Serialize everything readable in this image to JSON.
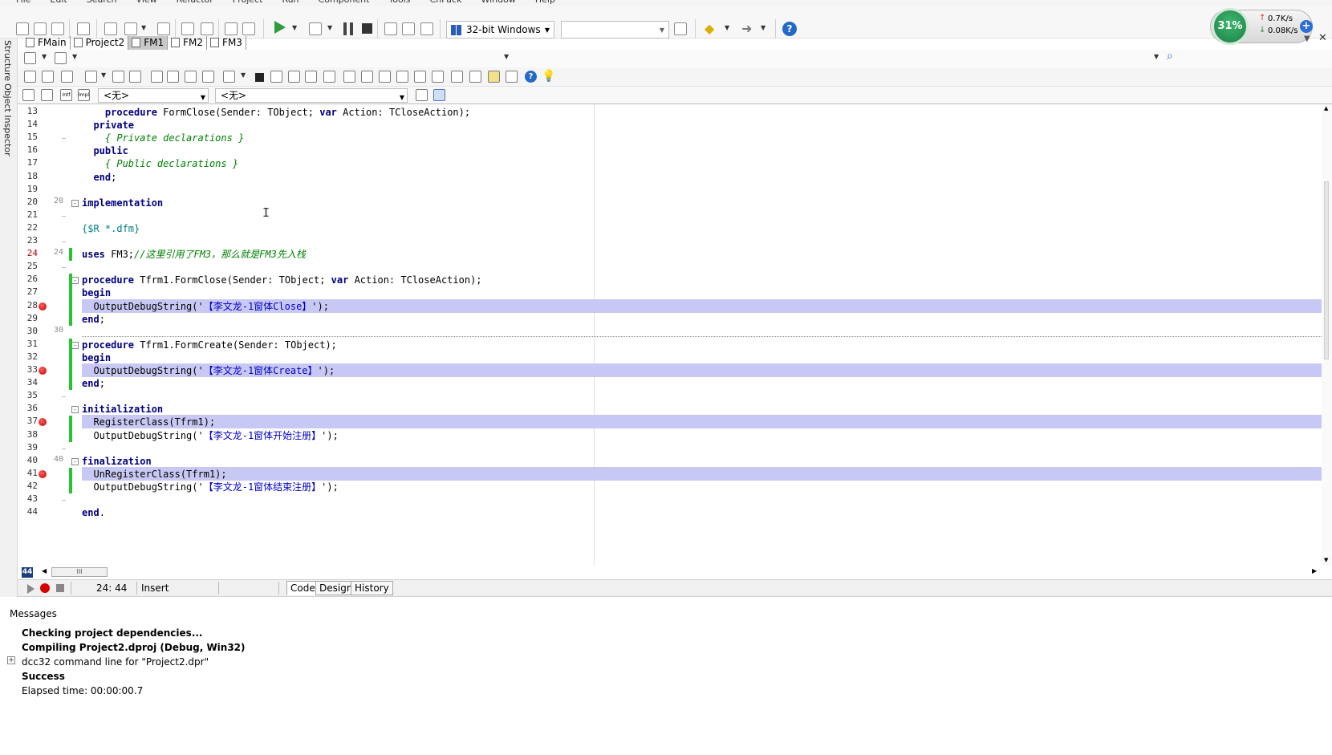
{
  "menu": [
    "File",
    "Edit",
    "Search",
    "View",
    "Refactor",
    "Project",
    "Run",
    "Component",
    "Tools",
    "CnPack",
    "Window",
    "Help"
  ],
  "toolbar": {
    "platform": "32-bit Windows",
    "config": ""
  },
  "speed_widget": {
    "cpu": "31%",
    "up": "0.7K/s",
    "down": "0.08K/s",
    "plus": "+"
  },
  "left_dock": {
    "tab_structure": "Structure",
    "tab_object_inspector": "Object Inspector"
  },
  "file_tabs": [
    {
      "label": "FMain",
      "active": false
    },
    {
      "label": "Project2",
      "active": false
    },
    {
      "label": "FM1",
      "active": true
    },
    {
      "label": "FM2",
      "active": false
    },
    {
      "label": "FM3",
      "active": false
    }
  ],
  "toolbar4": {
    "combo1": "<无>",
    "combo2": "<无>",
    "intf_label": "Intf",
    "impl_label": "Impl"
  },
  "editor": {
    "lines": [
      {
        "n": "13",
        "text": "    procedure FormClose(Sender: TObject; var Action: TCloseAction);"
      },
      {
        "n": "14",
        "text": "  private"
      },
      {
        "n": "15",
        "text": "    { Private declarations }"
      },
      {
        "n": "16",
        "text": "  public"
      },
      {
        "n": "17",
        "text": "    { Public declarations }"
      },
      {
        "n": "18",
        "text": "  end;"
      },
      {
        "n": "19",
        "text": ""
      },
      {
        "n": "20",
        "text": "implementation"
      },
      {
        "n": "21",
        "text": ""
      },
      {
        "n": "22",
        "text": "{$R *.dfm}"
      },
      {
        "n": "23",
        "text": ""
      },
      {
        "n": "24",
        "text": "uses FM3;//这里引用了FM3，那么就是FM3先入栈"
      },
      {
        "n": "25",
        "text": ""
      },
      {
        "n": "26",
        "text": "procedure Tfrm1.FormClose(Sender: TObject; var Action: TCloseAction);"
      },
      {
        "n": "27",
        "text": "begin"
      },
      {
        "n": "28",
        "text": "  OutputDebugString('【李文龙-1窗体Close】');"
      },
      {
        "n": "29",
        "text": "end;"
      },
      {
        "n": "30",
        "text": ""
      },
      {
        "n": "31",
        "text": "procedure Tfrm1.FormCreate(Sender: TObject);"
      },
      {
        "n": "32",
        "text": "begin"
      },
      {
        "n": "33",
        "text": "  OutputDebugString('【李文龙-1窗体Create】');"
      },
      {
        "n": "34",
        "text": "end;"
      },
      {
        "n": "35",
        "text": ""
      },
      {
        "n": "36",
        "text": "initialization"
      },
      {
        "n": "37",
        "text": "  RegisterClass(Tfrm1);"
      },
      {
        "n": "38",
        "text": "  OutputDebugString('【李文龙-1窗体开始注册】');"
      },
      {
        "n": "39",
        "text": ""
      },
      {
        "n": "40",
        "text": "finalization"
      },
      {
        "n": "41",
        "text": "  UnRegisterClass(Tfrm1);"
      },
      {
        "n": "42",
        "text": "  OutputDebugString('【李文龙-1窗体结束注册】');"
      },
      {
        "n": "43",
        "text": ""
      },
      {
        "n": "44",
        "text": "end."
      }
    ],
    "bookmarks": {
      "20": "20",
      "24": "24",
      "30": "30",
      "40": "40"
    },
    "col_badge": "44"
  },
  "statusbar": {
    "position": "24: 44",
    "mode": "Insert",
    "tabs": [
      "Code",
      "Design",
      "History"
    ]
  },
  "messages": {
    "title": "Messages",
    "items": [
      "Checking project dependencies...",
      "Compiling Project2.dproj (Debug, Win32)",
      "dcc32 command line for \"Project2.dpr\"",
      "Success",
      "Elapsed time: 00:00:00.7"
    ]
  },
  "colors": {
    "keyword": "#000080",
    "comment": "#008000",
    "string": "#0000c8",
    "highlight": "#c8c8f4",
    "breakpoint": "#c00000",
    "modified_bar": "#27c42f"
  }
}
